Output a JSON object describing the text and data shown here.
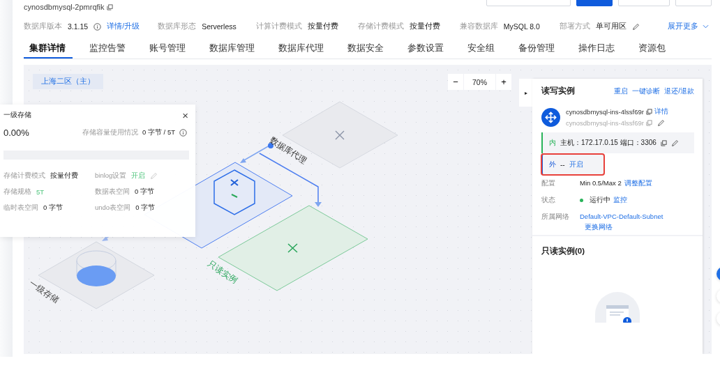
{
  "cluster": {
    "name": "cynosdbmysql-2pmrqfik"
  },
  "info": [
    {
      "label": "数据库版本",
      "value": "3.1.15",
      "kind": "version",
      "link": "详情/升级"
    },
    {
      "label": "数据库形态",
      "value": "Serverless",
      "kind": "plain"
    },
    {
      "label": "计算计费模式",
      "value": "按量付费",
      "kind": "plain"
    },
    {
      "label": "存储计费模式",
      "value": "按量付费",
      "kind": "plain"
    },
    {
      "label": "兼容数据库",
      "value": "MySQL 8.0",
      "kind": "plain"
    },
    {
      "label": "部署方式",
      "value": "单可用区",
      "kind": "editable"
    }
  ],
  "expand_more": "展开更多",
  "tabs": [
    {
      "label": "集群详情",
      "selected": true
    },
    {
      "label": "监控告警",
      "selected": false
    },
    {
      "label": "账号管理",
      "selected": false
    },
    {
      "label": "数据库管理",
      "selected": false
    },
    {
      "label": "数据库代理",
      "selected": false
    },
    {
      "label": "数据安全",
      "selected": false
    },
    {
      "label": "参数设置",
      "selected": false
    },
    {
      "label": "安全组",
      "selected": false
    },
    {
      "label": "备份管理",
      "selected": false
    },
    {
      "label": "操作日志",
      "selected": false
    },
    {
      "label": "资源包",
      "selected": false
    }
  ],
  "canvas": {
    "zone": "上海二区（主）",
    "zoom": {
      "minus": "−",
      "value": "70%",
      "plus": "+"
    },
    "labels": {
      "proxy": "数据库代理",
      "readonly": "只读实例",
      "storage": "一级存储"
    }
  },
  "storage_popover": {
    "title": "一级存储",
    "close": "×",
    "percent": "0.00%",
    "usage_label": "存储容量使用情况",
    "usage_value": "0 字节 / 5T",
    "level": 0,
    "fields": [
      {
        "label": "存储计费模式",
        "value": "按量付费",
        "kind": "plain"
      },
      {
        "label": "binlog设置",
        "value": "开启",
        "kind": "editable"
      },
      {
        "label": "存储规格",
        "value": "5T",
        "kind": "green"
      },
      {
        "label": "数据表空间",
        "value": "0 字节",
        "kind": "plain"
      },
      {
        "label": "临时表空间",
        "value": "0 字节",
        "kind": "plain"
      },
      {
        "label": "undo表空间",
        "value": "0 字节",
        "kind": "plain"
      }
    ]
  },
  "panel": {
    "toggle": "▸",
    "title": "读写实例",
    "actions": [
      "重启",
      "一键诊断",
      "退还/退款"
    ],
    "instance": {
      "name": "cynosdbmysql-ins-4lssf69r",
      "detail": "详情",
      "id": "cynosdbmysql-ins-4lssf69r"
    },
    "networks": [
      {
        "tag": "内",
        "text": "主机：172.17.0.15 端口：3306",
        "kind": "internal",
        "highlighted": false
      },
      {
        "tag": "外",
        "text": "--",
        "link": "开启",
        "kind": "external",
        "highlighted": true
      }
    ],
    "rows": [
      {
        "label": "配置",
        "value": "Min 0.5/Max 2",
        "link": "调整配置"
      },
      {
        "label": "状态",
        "value": "运行中",
        "link": "监控",
        "color": "#29b35a"
      },
      {
        "label": "所属网络",
        "link": "Default-VPC-Default-Subnet",
        "link2": "更换网络"
      }
    ],
    "readonly_title": "只读实例(0)"
  }
}
